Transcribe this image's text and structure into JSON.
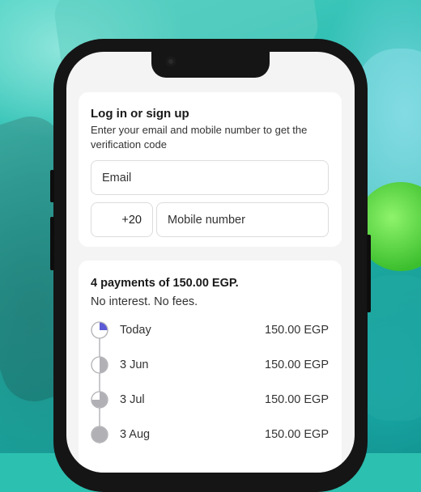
{
  "login": {
    "title": "Log in or sign up",
    "subtitle": "Enter your email and mobile number to get the verification code",
    "email_placeholder": "Email",
    "country_code": "+20",
    "mobile_placeholder": "Mobile number"
  },
  "payments": {
    "title": "4 payments of 150.00 EGP.",
    "subtitle": "No interest. No fees.",
    "schedule": [
      {
        "label": "Today",
        "amount": "150.00 EGP",
        "progress": 0.25,
        "color": "#5b5bd6"
      },
      {
        "label": "3 Jun",
        "amount": "150.00 EGP",
        "progress": 0.5,
        "color": "#b0b0b5"
      },
      {
        "label": "3 Jul",
        "amount": "150.00 EGP",
        "progress": 0.75,
        "color": "#b0b0b5"
      },
      {
        "label": "3 Aug",
        "amount": "150.00 EGP",
        "progress": 1.0,
        "color": "#b0b0b5"
      }
    ]
  }
}
